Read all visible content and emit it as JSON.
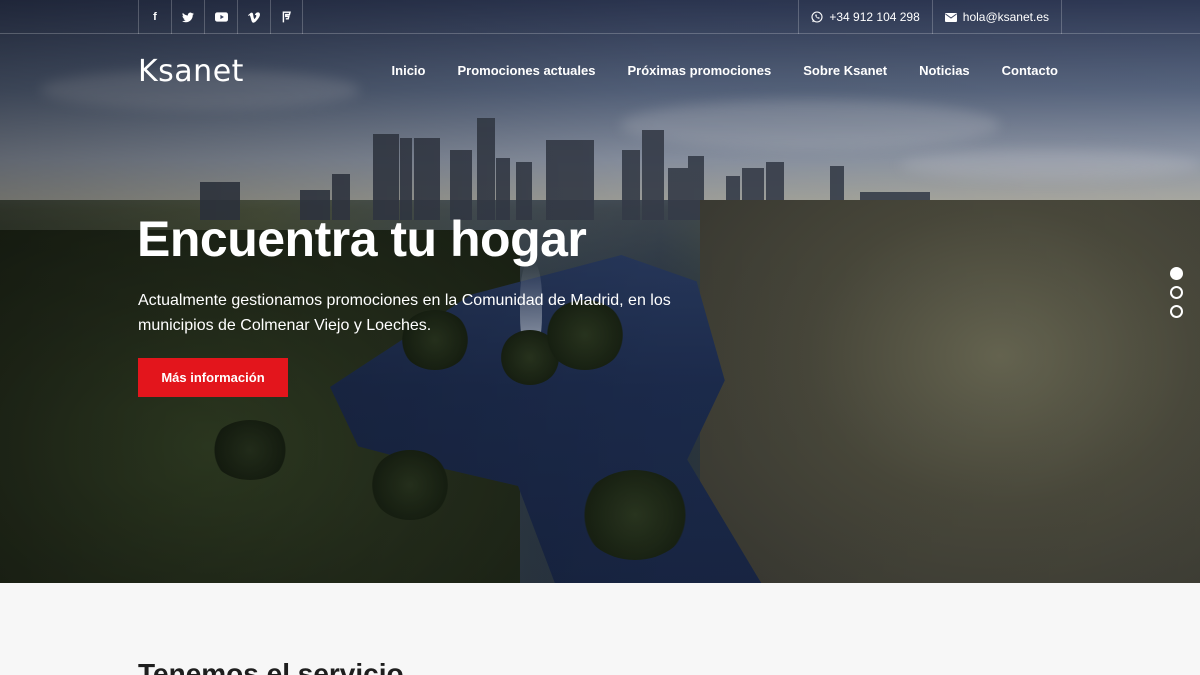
{
  "topbar": {
    "social": [
      {
        "name": "facebook-icon",
        "glyph": "f"
      },
      {
        "name": "twitter-icon",
        "glyph": "🐦"
      },
      {
        "name": "youtube-icon",
        "glyph": "▶"
      },
      {
        "name": "vimeo-icon",
        "glyph": "v"
      },
      {
        "name": "foursquare-icon",
        "glyph": "⚑"
      }
    ],
    "phone": "+34 912 104 298",
    "email": "hola@ksanet.es"
  },
  "header": {
    "logo": "Ksanet",
    "nav": [
      "Inicio",
      "Promociones actuales",
      "Próximas promociones",
      "Sobre Ksanet",
      "Noticias",
      "Contacto"
    ]
  },
  "hero": {
    "title": "Encuentra tu hogar",
    "text": "Actualmente gestionamos promociones en la Comunidad de Madrid, en los municipios de Colmenar Viejo y Loeches.",
    "button": "Más información",
    "slides_active": 1,
    "slides_total": 3
  },
  "section": {
    "title": "Tenemos el servicio"
  },
  "colors": {
    "accent": "#e3151c",
    "text_dark": "#1e1e1e",
    "page_bg": "#f7f7f7"
  }
}
